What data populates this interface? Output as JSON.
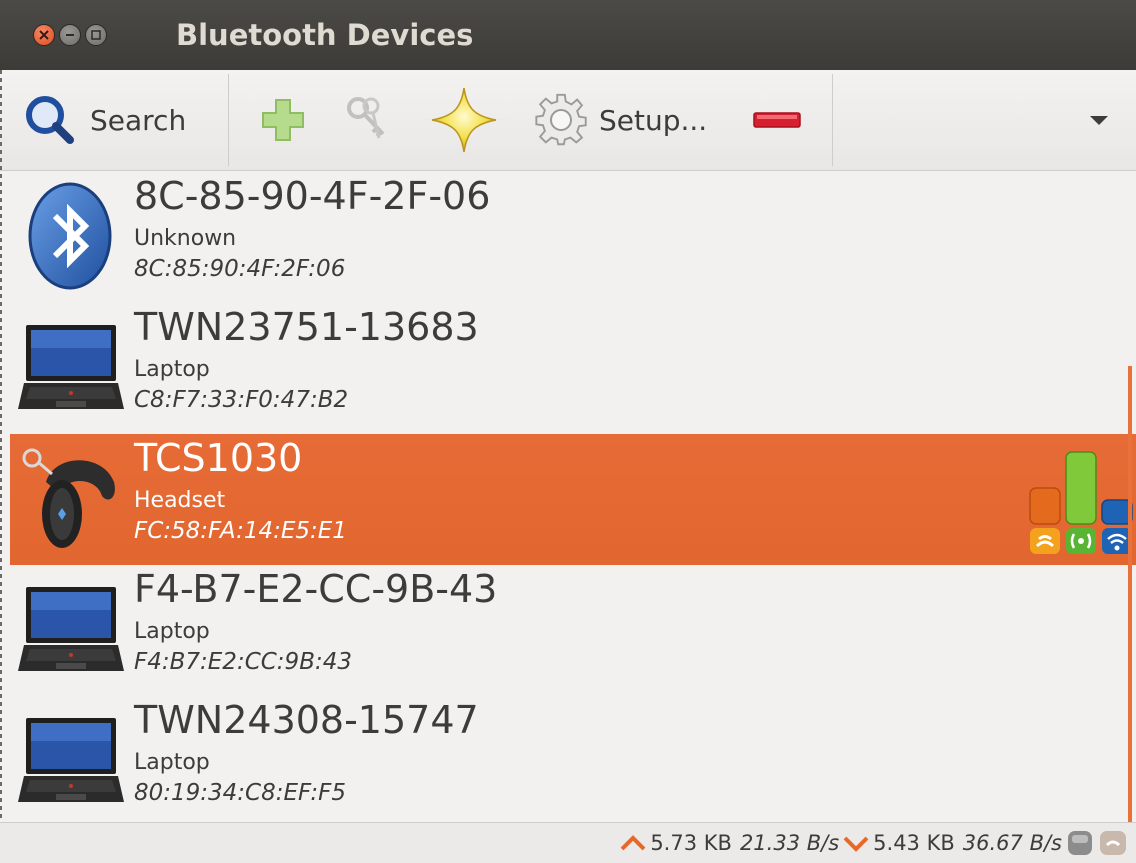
{
  "window": {
    "title": "Bluetooth Devices"
  },
  "toolbar": {
    "search_label": "Search",
    "setup_label": "Setup...",
    "icons": {
      "search": "search-icon",
      "add": "add-icon",
      "keys": "keys-icon",
      "trust": "star-icon",
      "setup": "gear-icon",
      "remove": "remove-icon",
      "menu": "chevron-down-icon"
    }
  },
  "devices": [
    {
      "name": "8C-85-90-4F-2F-06",
      "type": "Unknown",
      "address": "8C:85:90:4F:2F:06",
      "icon": "bluetooth-icon",
      "selected": false
    },
    {
      "name": "TWN23751-13683",
      "type": "Laptop",
      "address": "C8:F7:33:F0:47:B2",
      "icon": "laptop-icon",
      "selected": false
    },
    {
      "name": "TCS1030",
      "type": "Headset",
      "address": "FC:58:FA:14:E5:E1",
      "icon": "headset-icon",
      "selected": true,
      "signal": {
        "link_quality": 0.45,
        "rssi": 0.9,
        "tx_power": 0.3
      }
    },
    {
      "name": "F4-B7-E2-CC-9B-43",
      "type": "Laptop",
      "address": "F4:B7:E2:CC:9B:43",
      "icon": "laptop-icon",
      "selected": false
    },
    {
      "name": "TWN24308-15747",
      "type": "Laptop",
      "address": "80:19:34:C8:EF:F5",
      "icon": "laptop-icon",
      "selected": false
    }
  ],
  "status": {
    "upload_total": "5.73 KB",
    "upload_rate": "21.33 B/s",
    "download_total": "5.43 KB",
    "download_rate": "36.67 B/s"
  },
  "colors": {
    "selection": "#e2662f",
    "titlebar": "#3c3b37",
    "accent_up": "#e8682a",
    "accent_down": "#e8682a"
  }
}
